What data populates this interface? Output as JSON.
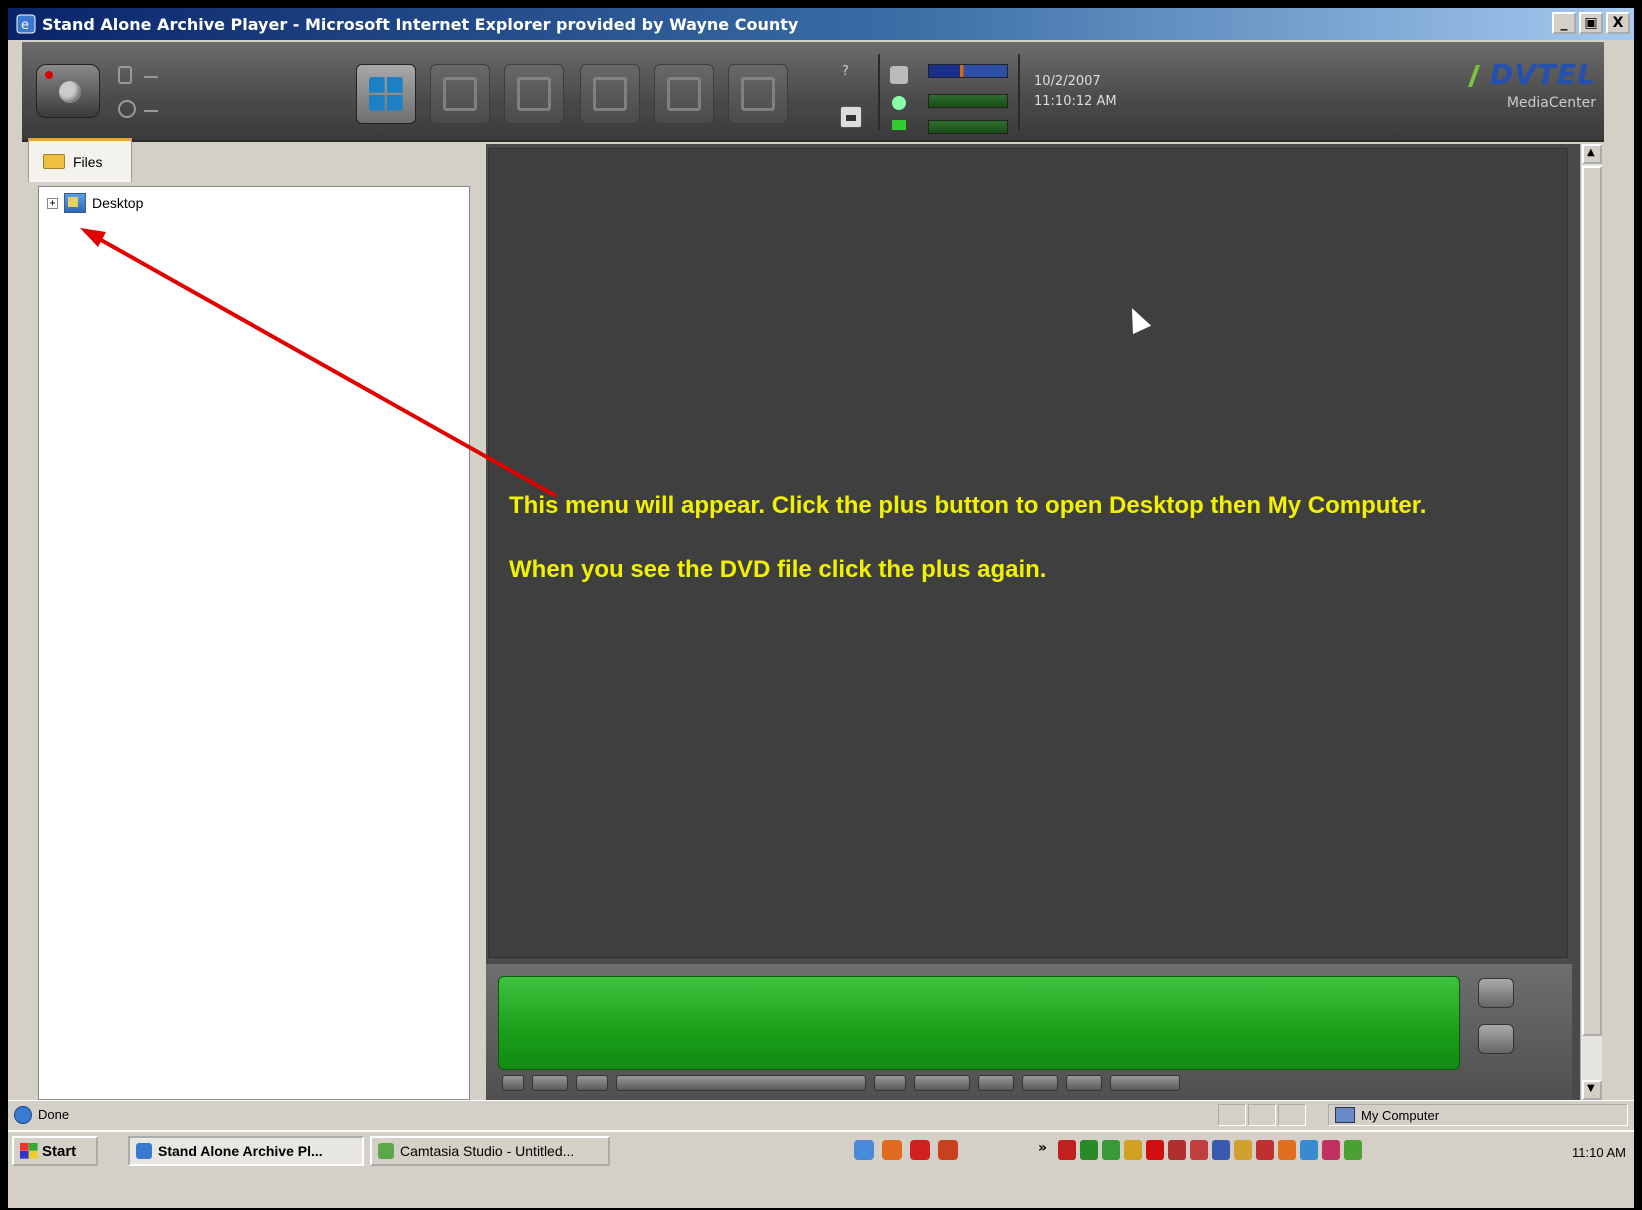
{
  "window": {
    "title": "Stand Alone Archive Player - Microsoft Internet Explorer provided by Wayne County",
    "minimize_label": "_",
    "restore_label": "▣",
    "close_label": "X"
  },
  "toolbar": {
    "help_label": "?",
    "date": "10/2/2007",
    "time": "11:10:12 AM",
    "logo_main": "DVTEL",
    "logo_sub": "MediaCenter"
  },
  "left_pane": {
    "tab_label": "Files",
    "tree": [
      {
        "label": "Desktop",
        "expander": "+"
      }
    ]
  },
  "viewer": {
    "instruction_line1": "This menu will appear. Click the plus button to open Desktop then My Computer.",
    "instruction_line2": "When you see the DVD file click the plus again."
  },
  "statusbar": {
    "status": "Done",
    "zone": "My Computer"
  },
  "taskbar": {
    "start_label": "Start",
    "tasks": [
      {
        "label": "Stand Alone Archive Pl..."
      },
      {
        "label": "Camtasia Studio - Untitled..."
      }
    ],
    "overflow": "»",
    "clock": "11:10 AM"
  },
  "colors": {
    "annotation_text": "#f2f200",
    "annotation_arrow": "#e00000",
    "timeline_green": "#1aa01a"
  }
}
